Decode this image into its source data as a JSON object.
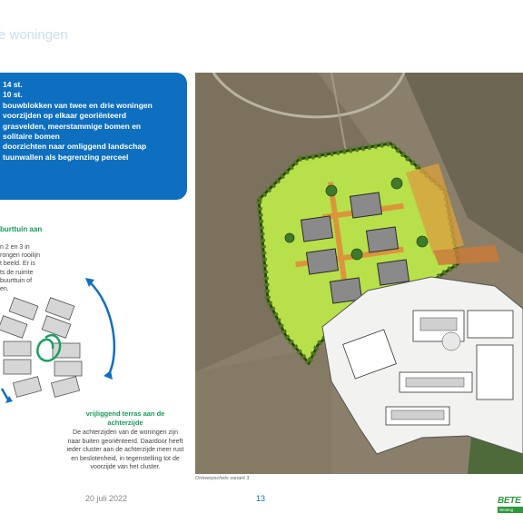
{
  "header": {
    "title": "e woningen"
  },
  "info_box": {
    "lines": [
      "14 st.",
      "10 st.",
      "bouwblokken van twee en drie woningen",
      "voorzijden op elkaar georiënteerd",
      "grasvelden, meerstammige bomen en",
      "solitaire bomen",
      "doorzichten naar omliggend landschap",
      "tuunwallen als begrenzing perceel"
    ]
  },
  "buurttuin": {
    "heading": "burttuin aan",
    "lines": [
      "n 2 en 3 in",
      "rongen rooilijn",
      "t beeld. Er is",
      "ts de ruimte",
      "buurttuin of",
      "en."
    ]
  },
  "terrace": {
    "heading_lines": [
      "vrijliggend terras aan de",
      "achterzijde"
    ],
    "body_lines": [
      "De achterzijden van de woningen zijn",
      "naar buiten georiënteerd. Daardoor heeft",
      "ieder cluster aan de achterzijde meer rust",
      "en beslotenheid, in tegenstelling tot de",
      "voorzijde van het cluster."
    ]
  },
  "caption": "Ontwerpschets variant 3",
  "footer": {
    "date": "20 juli 2022",
    "page": "13"
  },
  "logo": {
    "text": "BETE",
    "subtext": "Woning"
  },
  "colors": {
    "accent_blue": "#0e6fc0",
    "green_heading": "#1a9a5a",
    "lime_plan": "#b8e04a",
    "logo_green": "#2a9a3a"
  }
}
